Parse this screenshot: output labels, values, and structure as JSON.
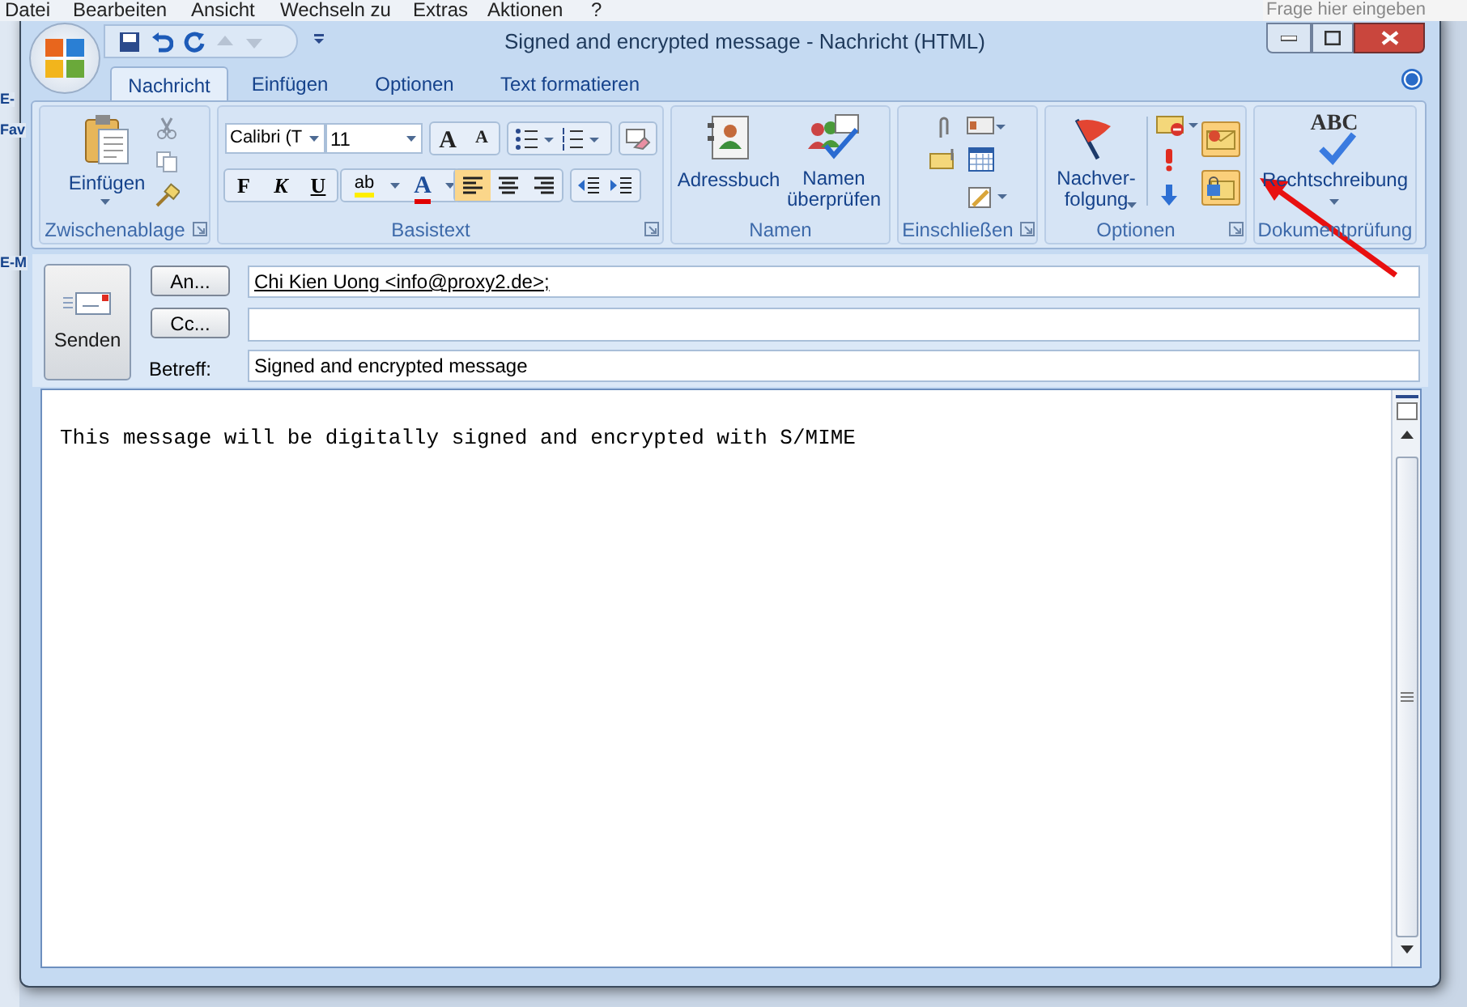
{
  "background_app": {
    "menu": [
      "Datei",
      "Bearbeiten",
      "Ansicht",
      "Wechseln zu",
      "Extras",
      "Aktionen",
      "?"
    ],
    "help_box": {
      "placeholder": "Frage hier eingeben"
    },
    "side_labels": [
      "E-",
      "Fav",
      "E-M"
    ]
  },
  "window": {
    "title": "Signed and encrypted message - Nachricht (HTML)"
  },
  "tabs": [
    {
      "label": "Nachricht",
      "selected": true
    },
    {
      "label": "Einfügen",
      "selected": false
    },
    {
      "label": "Optionen",
      "selected": false
    },
    {
      "label": "Text formatieren",
      "selected": false
    }
  ],
  "ribbon": {
    "clipboard": {
      "title": "Zwischenablage",
      "paste": "Einfügen"
    },
    "basic_text": {
      "title": "Basistext",
      "font": "Calibri (T",
      "size": "11",
      "grow": "A",
      "shrink": "A",
      "bold": "F",
      "italic": "K",
      "underline": "U",
      "highlight": "ab",
      "font_color": "A",
      "alignments": [
        {
          "kind": "left",
          "selected": true
        },
        {
          "kind": "center",
          "selected": false
        },
        {
          "kind": "right",
          "selected": false
        }
      ]
    },
    "names": {
      "title": "Namen",
      "buttons": [
        "Adressbuch",
        "Namen überprüfen"
      ]
    },
    "include": {
      "title": "Einschließen"
    },
    "options": {
      "title": "Optionen",
      "follow_up": [
        "Nachver-",
        "folgung"
      ],
      "toggles": [
        {
          "kind": "signature",
          "selected": true
        },
        {
          "kind": "encryption",
          "selected": true
        }
      ]
    },
    "proofing": {
      "title": "Dokumentprüfung",
      "logo": "ABC",
      "button": "Rechtschreibung"
    }
  },
  "header": {
    "send": "Senden",
    "to": {
      "button": "An...",
      "value": "Chi Kien Uong <info@proxy2.de>;"
    },
    "cc": {
      "button": "Cc..."
    },
    "subject": {
      "label": "Betreff:",
      "value": "Signed and encrypted message"
    }
  },
  "body": {
    "text": "This message will be digitally signed and encrypted with S/MIME"
  }
}
